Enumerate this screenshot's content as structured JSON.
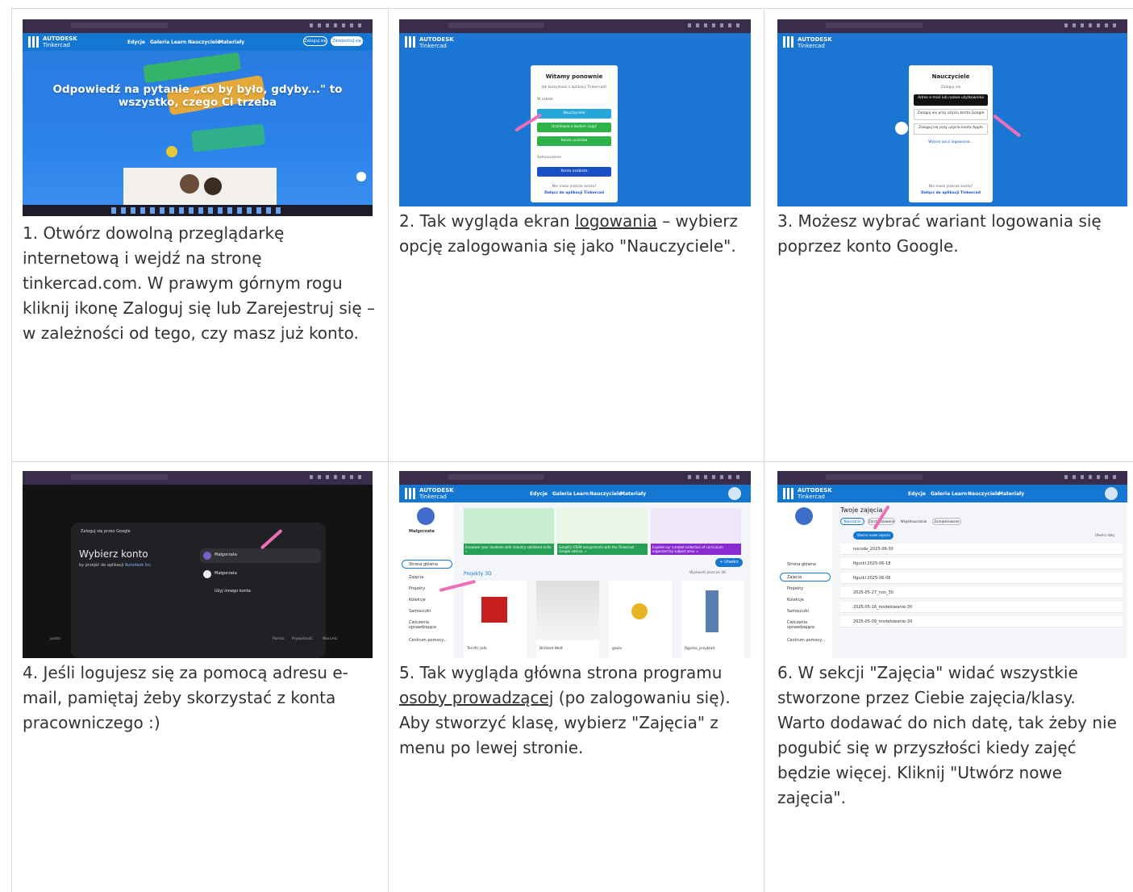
{
  "cells": [
    {
      "caption_parts": [
        "1. Otwórz dowolną przeglądarkę internetową i wejdź na stronę tinkercad.com. W prawym górnym rogu kliknij ikonę Zaloguj się lub Zarejestruj się – w zależności od tego, czy masz już konto."
      ],
      "screenshot": {
        "brand": "AUTODESK",
        "product": "Tinkercad",
        "nav": [
          "Edycje",
          "Galeria",
          "Learn",
          "Nauczyciele",
          "Materiały"
        ],
        "login_button": "Zaloguj się",
        "register_button": "Zarejestruj się",
        "hero_title": "Odpowiedź na pytanie „co by było, gdyby...\" to wszystko, czego Ci trzeba"
      }
    },
    {
      "caption_before": "2. Tak wygląda ekran ",
      "caption_link": "logowania",
      "caption_after": " – wybierz opcję zalogowania się jako \"Nauczyciele\".",
      "screenshot": {
        "brand": "AUTODESK",
        "product": "Tinkercad",
        "title": "Witamy ponownie",
        "subtitle": "Jak korzystasz z aplikacji Tinkercad?",
        "school_label": "W szkole",
        "buttons": [
          "Nauczyciele",
          "Uczniowie z kodem zajęć",
          "Konta uczniów"
        ],
        "self_label": "Samouczenie",
        "personal_button": "Konta osobiste",
        "no_account": "Nie masz jeszcze konta?",
        "join": "Dołącz do aplikacji Tinkercad"
      }
    },
    {
      "caption_parts": [
        "3. Możesz wybrać wariant logowania się poprzez konto Google."
      ],
      "screenshot": {
        "brand": "AUTODESK",
        "product": "Tinkercad",
        "title": "Nauczyciele",
        "subtitle": "Zaloguj się",
        "options": [
          "Adres e-mail lub nazwa użytkownika",
          "Zaloguj się przy użyciu konta Google",
          "Zaloguj się przy użyciu konta Apple"
        ],
        "more": "Więcej opcji logowania...",
        "no_account": "Nie masz jeszcze konta?",
        "join": "Dołącz do aplikacji Tinkercad"
      }
    },
    {
      "caption_parts": [
        "4. Jeśli logujesz się za pomocą adresu e-mail, pamiętaj żeby skorzystać z konta pracowniczego :)"
      ],
      "screenshot": {
        "header": "Zaloguj się przez Google",
        "title": "Wybierz konto",
        "subtitle_prefix": "by przejść do aplikacji ",
        "subtitle_app": "Autodesk Inc",
        "accounts": [
          "Małgorzata",
          "Małgorzata"
        ],
        "other_account": "Użyj innego konta",
        "footer_lang": "polski",
        "footer_links": [
          "Pomoc",
          "Prywatność",
          "Warunki"
        ]
      }
    },
    {
      "caption_before": "5. Tak wygląda główna strona programu ",
      "caption_link": "osoby prowadzącej",
      "caption_after": " (po zalogowaniu się). Aby stworzyć klasę, wybierz \"Zajęcia\" z menu po lewej stronie.",
      "screenshot": {
        "brand": "AUTODESK",
        "product": "Tinkercad",
        "nav": [
          "Edycje",
          "Galeria",
          "Learn",
          "Nauczyciele",
          "Materiały"
        ],
        "user": "Małgorzata",
        "side": [
          "Strona główna",
          "Zajęcia",
          "Projekty",
          "Kolekcje",
          "Samouczki",
          "Ćwiczenia sprawdzające",
          "Centrum pomocy..."
        ],
        "banners": [
          "Empower your students with industry validated skills. »",
          "Simplify STEM assignments with the Tinkercad Google add-on. »",
          "Explore our curated collection of curriculum organized by subject area. »"
        ],
        "create": "+ Utwórz",
        "section": "Projekty 3D",
        "see_all": "Wyświetl jeszcze 36",
        "projects": [
          "Terrific Jofo",
          "Brilliant Wolt",
          "gosia",
          "figurka_przyklad"
        ]
      }
    },
    {
      "caption_parts": [
        "6. W sekcji \"Zajęcia\" widać wszystkie stworzone przez Ciebie zajęcia/klasy. Warto dodawać do nich datę, tak żeby nie pogubić się w przyszłości kiedy zajęć będzie więcej. Kliknij \"Utwórz nowe zajęcia\"."
      ],
      "screenshot": {
        "brand": "AUTODESK",
        "product": "Tinkercad",
        "nav": [
          "Edycje",
          "Galeria",
          "Learn",
          "Nauczyciele",
          "Materiały"
        ],
        "title": "Twoje zajęcia",
        "filters": [
          "Nauczanie",
          "Zarchiwizowane",
          "Współnauczanie",
          "Zarejestrowane"
        ],
        "new_button": "Utwórz nowe zajęcia",
        "sort": "Utwórz daty",
        "side": [
          "Strona główna",
          "Zajęcia",
          "Projekty",
          "Kolekcje",
          "Samouczki",
          "Ćwiczenia sprawdzające",
          "Centrum pomocy..."
        ],
        "classes": [
          "nocode_2025-06-30",
          "figurki 2025-06-18",
          "figurki 2025-06-06",
          "2025-05-27_non_30",
          "2025-05-16_modelowanie-30",
          "2025-05-09_modelowanie-30"
        ]
      }
    }
  ]
}
